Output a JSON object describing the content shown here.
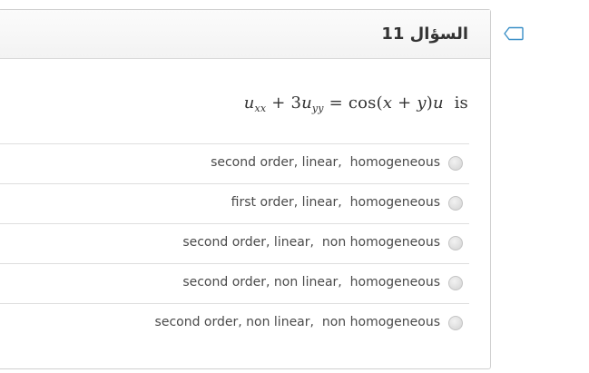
{
  "question": {
    "title": "السؤال 11",
    "text_prefix_u": "u",
    "text_sub_xx": "xx",
    "text_plus_3": " + 3",
    "text_u2": "u",
    "text_sub_yy": "yy",
    "text_eq": " = cos(",
    "text_x": "x",
    "text_plus": " + ",
    "text_y": "y",
    "text_close": ")",
    "text_u3": "u",
    "text_is": "  is"
  },
  "answers": [
    {
      "label": "second order, linear,  homogeneous",
      "selected": false
    },
    {
      "label": "first order, linear,  homogeneous",
      "selected": false
    },
    {
      "label": "second order, linear,  non homogeneous",
      "selected": false
    },
    {
      "label": "second order, non linear,  homogeneous",
      "selected": false
    },
    {
      "label": "second order, non linear,  non homogeneous",
      "selected": false
    }
  ],
  "icons": {
    "flag": "flag-outline-icon"
  },
  "colors": {
    "flag_border": "#3a8fc7",
    "card_border": "#cfcfcf"
  }
}
